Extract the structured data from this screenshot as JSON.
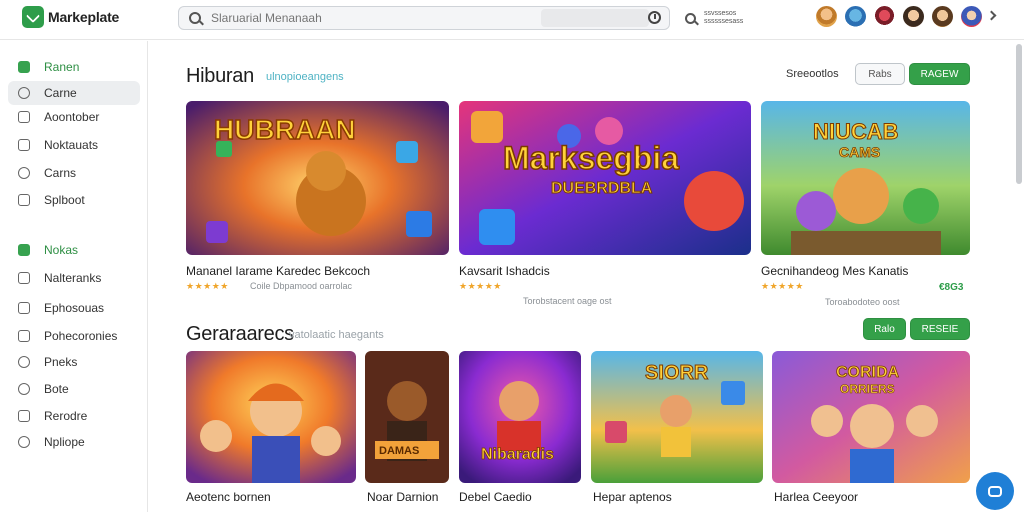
{
  "app": {
    "title": "Markeplate",
    "accent_color": "#34a049",
    "brand_color": "#2e9d4a"
  },
  "search": {
    "placeholder": "Slaruarial Menanaah",
    "secondary_text": "ssvssesos ssssssesass"
  },
  "header": {
    "avatars": [
      "avatar-1",
      "avatar-2",
      "avatar-3",
      "avatar-4",
      "avatar-5",
      "avatar-6"
    ]
  },
  "sidebar": {
    "items": [
      {
        "label": "Ranen",
        "icon": "home-icon",
        "style": "green"
      },
      {
        "label": "Carne",
        "icon": "game-icon",
        "style": "selected"
      },
      {
        "label": "Aoontober",
        "icon": "grid-icon",
        "style": "normal"
      },
      {
        "label": "Noktauats",
        "icon": "folder-icon",
        "style": "normal"
      },
      {
        "label": "Carns",
        "icon": "tag-icon",
        "style": "normal"
      },
      {
        "label": "Splboot",
        "icon": "box-icon",
        "style": "normal"
      },
      {
        "label": "Nokas",
        "icon": "chart-icon",
        "style": "green"
      },
      {
        "label": "Nalteranks",
        "icon": "list-icon",
        "style": "normal"
      },
      {
        "label": "Ephosouas",
        "icon": "doc-icon",
        "style": "normal"
      },
      {
        "label": "Pohecoronies",
        "icon": "calendar-icon",
        "style": "normal"
      },
      {
        "label": "Pneks",
        "icon": "pin-icon",
        "style": "normal"
      },
      {
        "label": "Bote",
        "icon": "circle-icon",
        "style": "normal"
      },
      {
        "label": "Rerodre",
        "icon": "table-icon",
        "style": "normal"
      },
      {
        "label": "Npliope",
        "icon": "drop-icon",
        "style": "normal"
      }
    ]
  },
  "section1": {
    "title": "Hiburan",
    "subtitle": "ulnopioeangens",
    "header_label": "Sreeootlos",
    "button_outline": "Rabs",
    "button_green": "RAGEW",
    "cards": [
      {
        "title": "Mananel Iarame Karedec Bekcoch",
        "stars": "★★★★★",
        "meta": "Coile Dbpamood oarrolac",
        "price": ""
      },
      {
        "title": "Kavsarit Ishadcis",
        "stars": "★★★★★",
        "meta": "Torobstacent oage ost",
        "price": ""
      },
      {
        "title": "Gecnihandeog Mes Kanatis",
        "stars": "★★★★★",
        "meta": "Toroabodoteo oost",
        "price": "€8G3"
      }
    ]
  },
  "section2": {
    "title": "Geraraarecs",
    "subtitle": "vatolaatic haegants",
    "button_small": "Ralo",
    "button_large": "RESEIE",
    "cards": [
      {
        "title": "Aeotenc bornen"
      },
      {
        "title": "Noar Darnion"
      },
      {
        "title": "Debel Caedio"
      },
      {
        "title": "Hepar aptenos"
      },
      {
        "title": "Harlea Ceeyoor"
      }
    ]
  }
}
